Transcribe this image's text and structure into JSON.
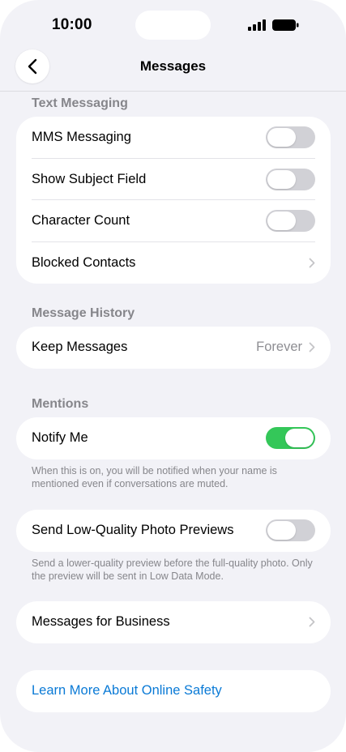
{
  "status_bar": {
    "time": "10:00"
  },
  "nav": {
    "title": "Messages"
  },
  "sections": {
    "text_messaging": {
      "header": "Text Messaging",
      "mms": {
        "label": "MMS Messaging",
        "on": false
      },
      "subject": {
        "label": "Show Subject Field",
        "on": false
      },
      "char_count": {
        "label": "Character Count",
        "on": false
      },
      "blocked": {
        "label": "Blocked Contacts"
      }
    },
    "history": {
      "header": "Message History",
      "keep": {
        "label": "Keep Messages",
        "value": "Forever"
      }
    },
    "mentions": {
      "header": "Mentions",
      "notify": {
        "label": "Notify Me",
        "on": true
      },
      "footer": "When this is on, you will be notified when your name is mentioned even if conversations are muted."
    },
    "low_quality": {
      "label": "Send Low-Quality Photo Previews",
      "on": false,
      "footer": "Send a lower-quality preview before the full-quality photo. Only the preview will be sent in Low Data Mode."
    },
    "business": {
      "label": "Messages for Business"
    },
    "safety": {
      "label": "Learn More About Online Safety"
    }
  },
  "colors": {
    "background": "#f2f2f7",
    "toggle_on": "#34c759",
    "toggle_off": "#d1d1d6",
    "link": "#0a7ad6",
    "secondary_text": "#86868b"
  },
  "icons": [
    "chevron-left-icon",
    "chevron-right-icon",
    "cellular-signal-icon",
    "battery-icon"
  ]
}
